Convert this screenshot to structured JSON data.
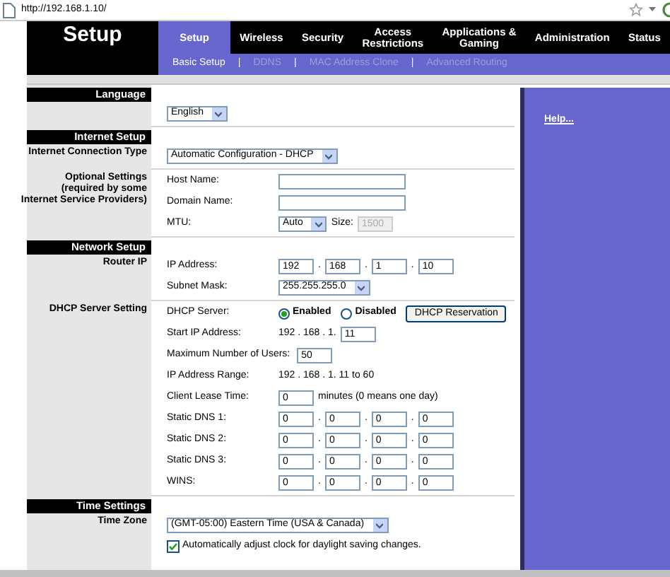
{
  "address_bar": {
    "url": "http://192.168.1.10/"
  },
  "page_title": "Setup",
  "tabs": [
    {
      "label": "Setup",
      "selected": true
    },
    {
      "label": "Wireless",
      "selected": false
    },
    {
      "label": "Security",
      "selected": false
    },
    {
      "label": "Access\nRestrictions",
      "selected": false
    },
    {
      "label": "Applications &\nGaming",
      "selected": false
    },
    {
      "label": "Administration",
      "selected": false
    },
    {
      "label": "Status",
      "selected": false
    }
  ],
  "subtabs": [
    {
      "label": "Basic Setup",
      "selected": true
    },
    {
      "label": "DDNS",
      "selected": false
    },
    {
      "label": "MAC Address Clone",
      "selected": false
    },
    {
      "label": "Advanced Routing",
      "selected": false
    }
  ],
  "subtab_separators": [
    "|",
    "|",
    "|"
  ],
  "sections": [
    {
      "title": "Language",
      "groups": [
        {
          "rows": [
            {
              "controls": [
                {
                  "kind": "select",
                  "value": "English"
                }
              ]
            }
          ]
        }
      ]
    },
    {
      "title": "Internet Setup",
      "groups": [
        {
          "label": "Internet Connection Type",
          "rows": [
            {
              "controls": [
                {
                  "kind": "select",
                  "value": "Automatic Configuration - DHCP"
                }
              ]
            }
          ]
        },
        {
          "label": "Optional Settings\n(required by some\nInternet Service Providers)",
          "rows": [
            {
              "label": "Host Name:",
              "controls": [
                {
                  "kind": "wide_input"
                }
              ]
            },
            {
              "label": "Domain Name:",
              "controls": [
                {
                  "kind": "wide_input"
                }
              ]
            },
            {
              "label": "MTU:",
              "controls": [
                {
                  "kind": "select",
                  "value": "Auto"
                },
                {
                  "kind": "text",
                  "text": "Size:"
                },
                {
                  "kind": "input",
                  "value": "1500",
                  "disabled": true
                }
              ]
            }
          ]
        }
      ]
    },
    {
      "title": "Network Setup",
      "groups": [
        {
          "label": "Router IP",
          "rows": [
            {
              "label": "IP Address:",
              "controls": [
                {
                  "kind": "octets",
                  "values": [
                    "192",
                    "168",
                    "1",
                    "10"
                  ],
                  "separator": "."
                }
              ]
            },
            {
              "label": "Subnet Mask:",
              "controls": [
                {
                  "kind": "select",
                  "value": "255.255.255.0"
                }
              ]
            }
          ]
        },
        {
          "label": "DHCP Server Setting",
          "rows": [
            {
              "label": "DHCP Server:",
              "controls": [
                {
                  "kind": "radio",
                  "label": "Enabled",
                  "selected": true
                },
                {
                  "kind": "radio",
                  "label": "Disabled",
                  "selected": false
                },
                {
                  "kind": "button",
                  "label": "DHCP Reservation"
                }
              ]
            },
            {
              "label": "Start IP Address:",
              "controls": [
                {
                  "kind": "text",
                  "text": "192 . 168 . 1."
                },
                {
                  "kind": "input",
                  "value": "11"
                }
              ]
            },
            {
              "label": "Maximum Number of Users:",
              "controls": [
                {
                  "kind": "input",
                  "value": "50"
                }
              ]
            },
            {
              "label": "IP Address Range:",
              "controls": [
                {
                  "kind": "text",
                  "text": "192 . 168 . 1. 11 to 60"
                }
              ]
            },
            {
              "label": "Client Lease Time:",
              "controls": [
                {
                  "kind": "input",
                  "value": "0"
                },
                {
                  "kind": "text",
                  "text": "minutes (0 means one day)"
                }
              ]
            },
            {
              "label": "Static DNS 1:",
              "controls": [
                {
                  "kind": "octets",
                  "values": [
                    "0",
                    "0",
                    "0",
                    "0"
                  ],
                  "separator": "."
                }
              ]
            },
            {
              "label": "Static DNS 2:",
              "controls": [
                {
                  "kind": "octets",
                  "values": [
                    "0",
                    "0",
                    "0",
                    "0"
                  ],
                  "separator": "."
                }
              ]
            },
            {
              "label": "Static DNS 3:",
              "controls": [
                {
                  "kind": "octets",
                  "values": [
                    "0",
                    "0",
                    "0",
                    "0"
                  ],
                  "separator": "."
                }
              ]
            },
            {
              "label": "WINS:",
              "controls": [
                {
                  "kind": "octets",
                  "values": [
                    "0",
                    "0",
                    "0",
                    "0"
                  ],
                  "separator": "."
                }
              ]
            }
          ]
        }
      ]
    },
    {
      "title": "Time Settings",
      "groups": [
        {
          "label": "Time Zone",
          "rows": [
            {
              "controls": [
                {
                  "kind": "select",
                  "value": "(GMT-05:00) Eastern Time (USA & Canada)"
                }
              ]
            },
            {
              "controls": [
                {
                  "kind": "checkbox",
                  "label": "Automatically adjust clock for daylight saving changes.",
                  "checked": true
                }
              ]
            }
          ]
        }
      ]
    }
  ],
  "help": {
    "link": "Help..."
  }
}
